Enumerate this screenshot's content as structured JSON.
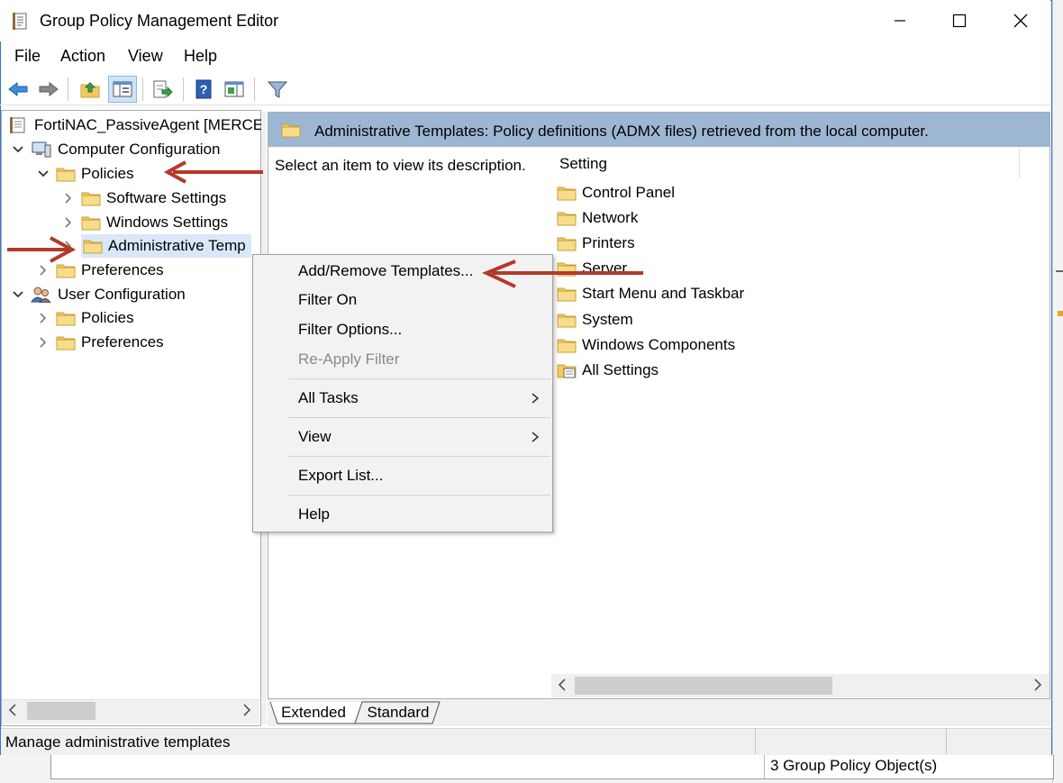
{
  "window": {
    "title": "Group Policy Management Editor"
  },
  "menu": [
    "File",
    "Action",
    "View",
    "Help"
  ],
  "tree": {
    "root": "FortiNAC_PassiveAgent [MERCE",
    "items": [
      {
        "label": "Computer Configuration"
      },
      {
        "label": "Policies"
      },
      {
        "label": "Software Settings"
      },
      {
        "label": "Windows Settings"
      },
      {
        "label": "Administrative Temp"
      },
      {
        "label": "Preferences"
      },
      {
        "label": "User Configuration"
      },
      {
        "label": "Policies"
      },
      {
        "label": "Preferences"
      }
    ]
  },
  "right_pane": {
    "header": "Administrative Templates: Policy definitions (ADMX files) retrieved from the local computer.",
    "description": "Select an item to view its description.",
    "column_header": "Setting",
    "items": [
      "Control Panel",
      "Network",
      "Printers",
      "Server",
      "Start Menu and Taskbar",
      "System",
      "Windows Components",
      "All Settings"
    ]
  },
  "tabs": [
    "Extended",
    "Standard"
  ],
  "status": {
    "text": "Manage administrative templates",
    "background_window_status": "3 Group Policy Object(s)"
  },
  "context_menu": {
    "items": [
      {
        "label": "Add/Remove Templates...",
        "enabled": true
      },
      {
        "label": "Filter On",
        "enabled": true
      },
      {
        "label": "Filter Options...",
        "enabled": true
      },
      {
        "label": "Re-Apply Filter",
        "enabled": false
      },
      {
        "label": "All Tasks",
        "enabled": true,
        "submenu": true
      },
      {
        "label": "View",
        "enabled": true,
        "submenu": true
      },
      {
        "label": "Export List...",
        "enabled": true
      },
      {
        "label": "Help",
        "enabled": true
      }
    ]
  },
  "colors": {
    "selection": "#d9e8f8",
    "header_band": "#9cb6d3",
    "annotation_arrow": "#b23a2a",
    "folder": "#f5d77a"
  }
}
